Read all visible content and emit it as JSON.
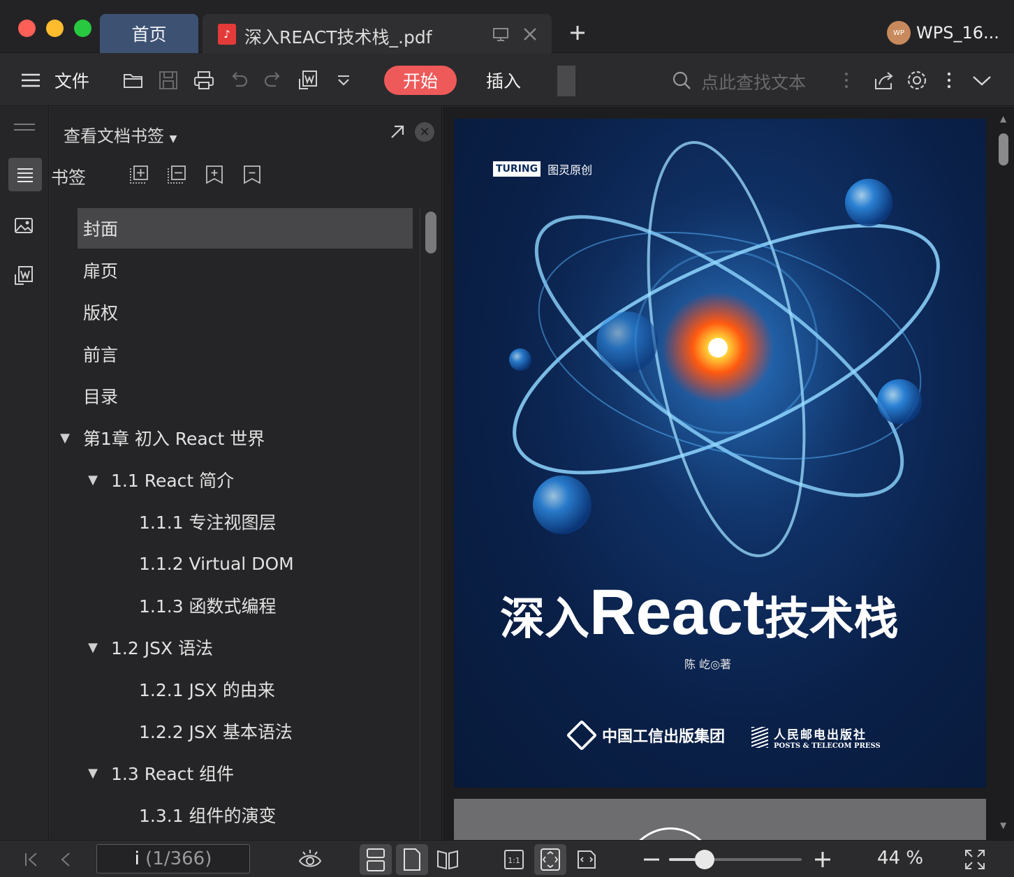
{
  "window": {
    "tabs": {
      "home": "首页",
      "doc": "深入REACT技术栈_.pdf"
    },
    "account": {
      "avatar_text": "WP",
      "name": "WPS_16..."
    }
  },
  "toolbar": {
    "menu_label": "文件",
    "start_label": "开始",
    "insert_label": "插入",
    "search_placeholder": "点此查找文本"
  },
  "panel": {
    "header": "查看文档书签",
    "bookmarks_label": "书签",
    "tree": [
      {
        "label": "封面",
        "level": 0,
        "expanded": null,
        "selected": true
      },
      {
        "label": "扉页",
        "level": 0,
        "expanded": null,
        "selected": false
      },
      {
        "label": "版权",
        "level": 0,
        "expanded": null,
        "selected": false
      },
      {
        "label": "前言",
        "level": 0,
        "expanded": null,
        "selected": false
      },
      {
        "label": "目录",
        "level": 0,
        "expanded": null,
        "selected": false
      },
      {
        "label": "第1章 初入 React 世界",
        "level": 0,
        "expanded": true,
        "selected": false
      },
      {
        "label": "1.1 React 简介",
        "level": 1,
        "expanded": true,
        "selected": false
      },
      {
        "label": "1.1.1 专注视图层",
        "level": 2,
        "expanded": null,
        "selected": false
      },
      {
        "label": "1.1.2 Virtual DOM",
        "level": 2,
        "expanded": null,
        "selected": false
      },
      {
        "label": "1.1.3 函数式编程",
        "level": 2,
        "expanded": null,
        "selected": false
      },
      {
        "label": "1.2 JSX 语法",
        "level": 1,
        "expanded": true,
        "selected": false
      },
      {
        "label": "1.2.1 JSX 的由来",
        "level": 2,
        "expanded": null,
        "selected": false
      },
      {
        "label": "1.2.2 JSX 基本语法",
        "level": 2,
        "expanded": null,
        "selected": false
      },
      {
        "label": "1.3 React 组件",
        "level": 1,
        "expanded": true,
        "selected": false
      },
      {
        "label": "1.3.1 组件的演变",
        "level": 2,
        "expanded": null,
        "selected": false
      }
    ]
  },
  "cover": {
    "publisher_logo": "TURING",
    "publisher_brand": "图灵原创",
    "title_cn_1": "深入",
    "title_en": "React",
    "title_cn_2": "技术栈",
    "author": "陈 屹◎著",
    "publisher_1": "中国工信出版集团",
    "publisher_2_cn": "人民邮电出版社",
    "publisher_2_en": "POSTS & TELECOM PRESS"
  },
  "statusbar": {
    "page_current": "i",
    "page_total": "(1/366)",
    "zoom": "44 %",
    "zoom_fraction": 0.27
  },
  "colors": {
    "accent_start": "#ee5a5a",
    "tab_home": "#3d5273",
    "selection": "#474749"
  }
}
